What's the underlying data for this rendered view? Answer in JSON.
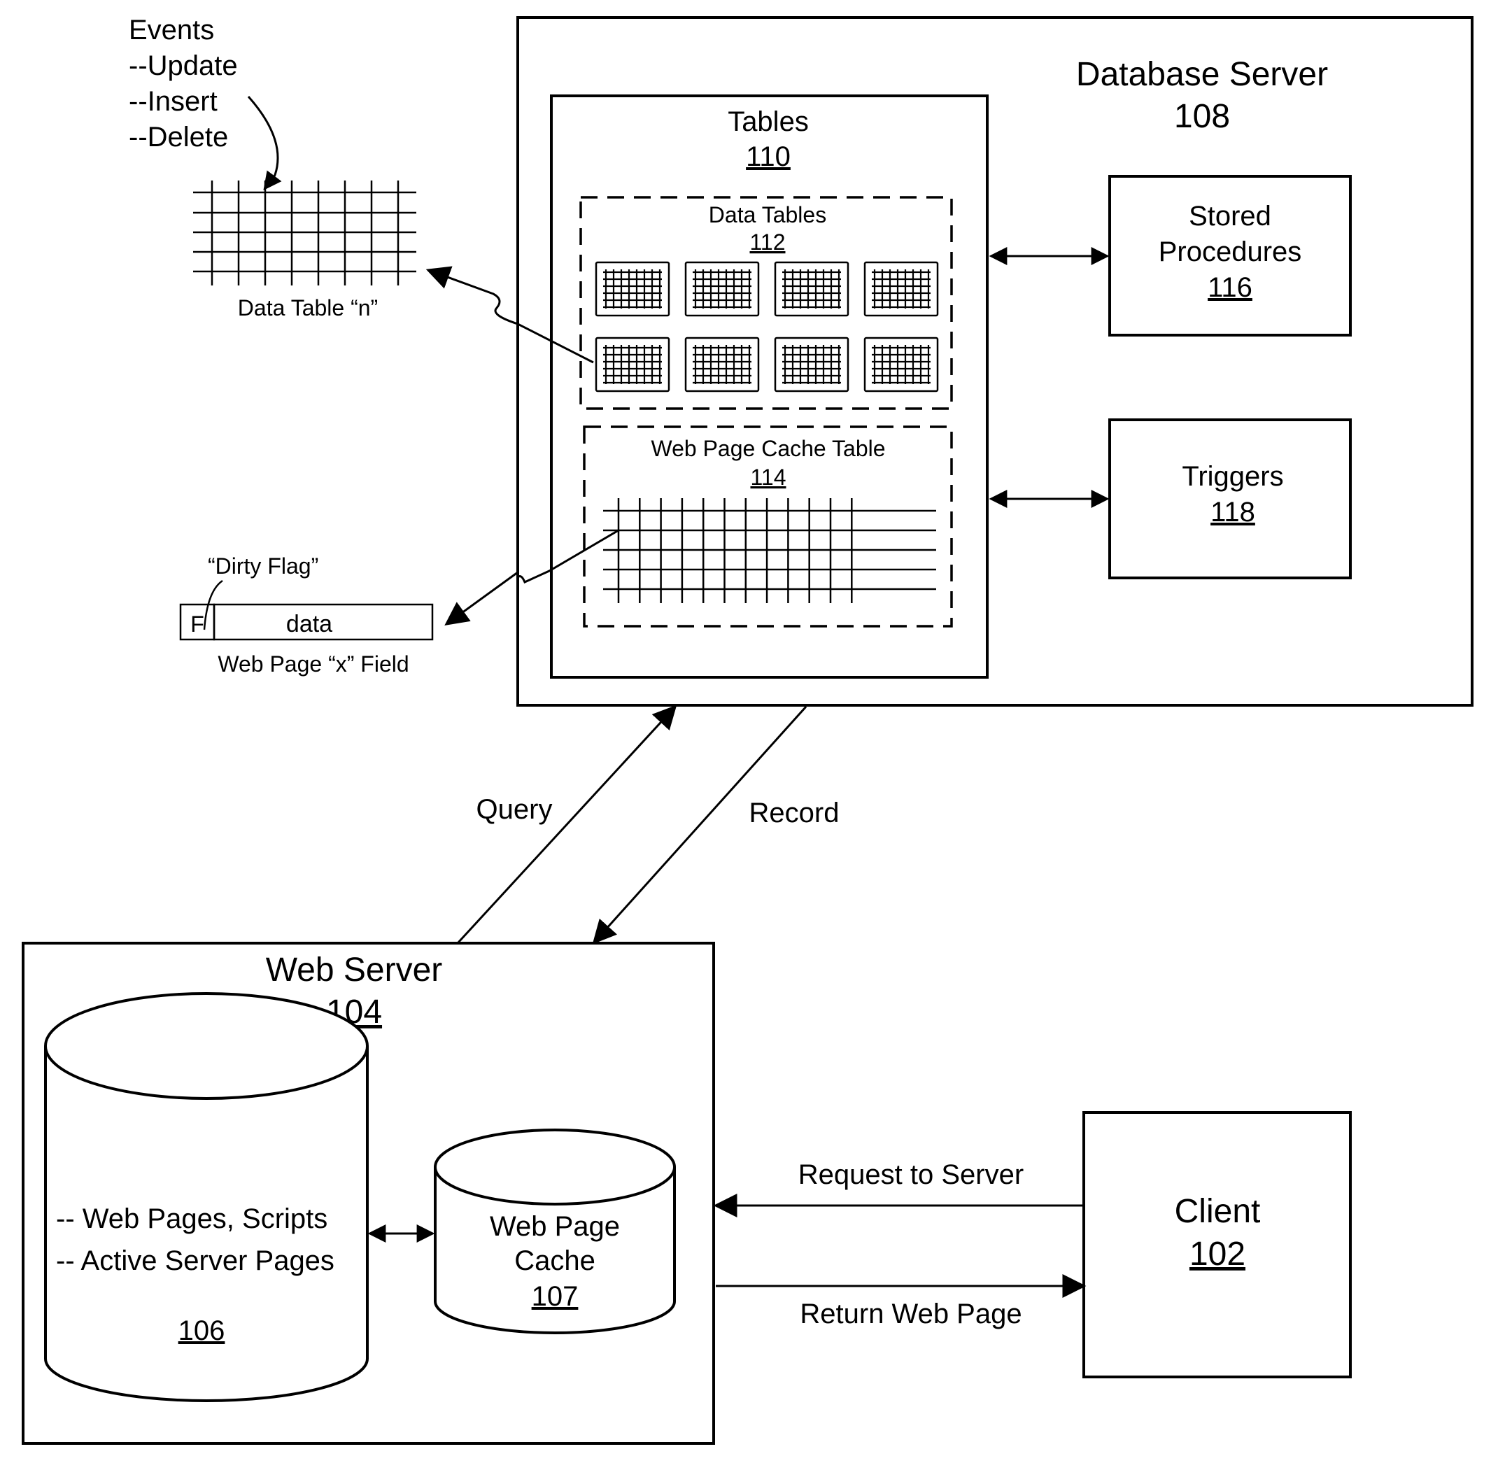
{
  "colors": {
    "ink": "#000000",
    "paper": "#ffffff"
  },
  "events": {
    "title": "Events",
    "items": [
      "--Update",
      "--Insert",
      "--Delete"
    ]
  },
  "data_table_n": {
    "label": "Data Table “n”"
  },
  "dirty_flag": {
    "callout": "“Dirty Flag”",
    "flag_cell": "F",
    "data_cell": "data",
    "field_label": "Web Page “x” Field"
  },
  "database_server": {
    "title": "Database Server",
    "number": "108"
  },
  "tables": {
    "title": "Tables",
    "number": "110"
  },
  "data_tables": {
    "title": "Data Tables",
    "number": "112",
    "count": 8
  },
  "cache_table": {
    "title": "Web Page Cache Table",
    "number": "114"
  },
  "stored_procedures": {
    "line1": "Stored",
    "line2": "Procedures",
    "number": "116"
  },
  "triggers": {
    "title": "Triggers",
    "number": "118"
  },
  "flows": {
    "query": "Query",
    "record": "Record",
    "request": "Request to Server",
    "return": "Return Web Page"
  },
  "web_server": {
    "title": "Web Server",
    "number": "104"
  },
  "storage": {
    "line1": "-- Web Pages, Scripts",
    "line2": "-- Active Server Pages",
    "number": "106"
  },
  "web_page_cache": {
    "line1": "Web Page",
    "line2": "Cache",
    "number": "107"
  },
  "client": {
    "title": "Client",
    "number": "102"
  }
}
